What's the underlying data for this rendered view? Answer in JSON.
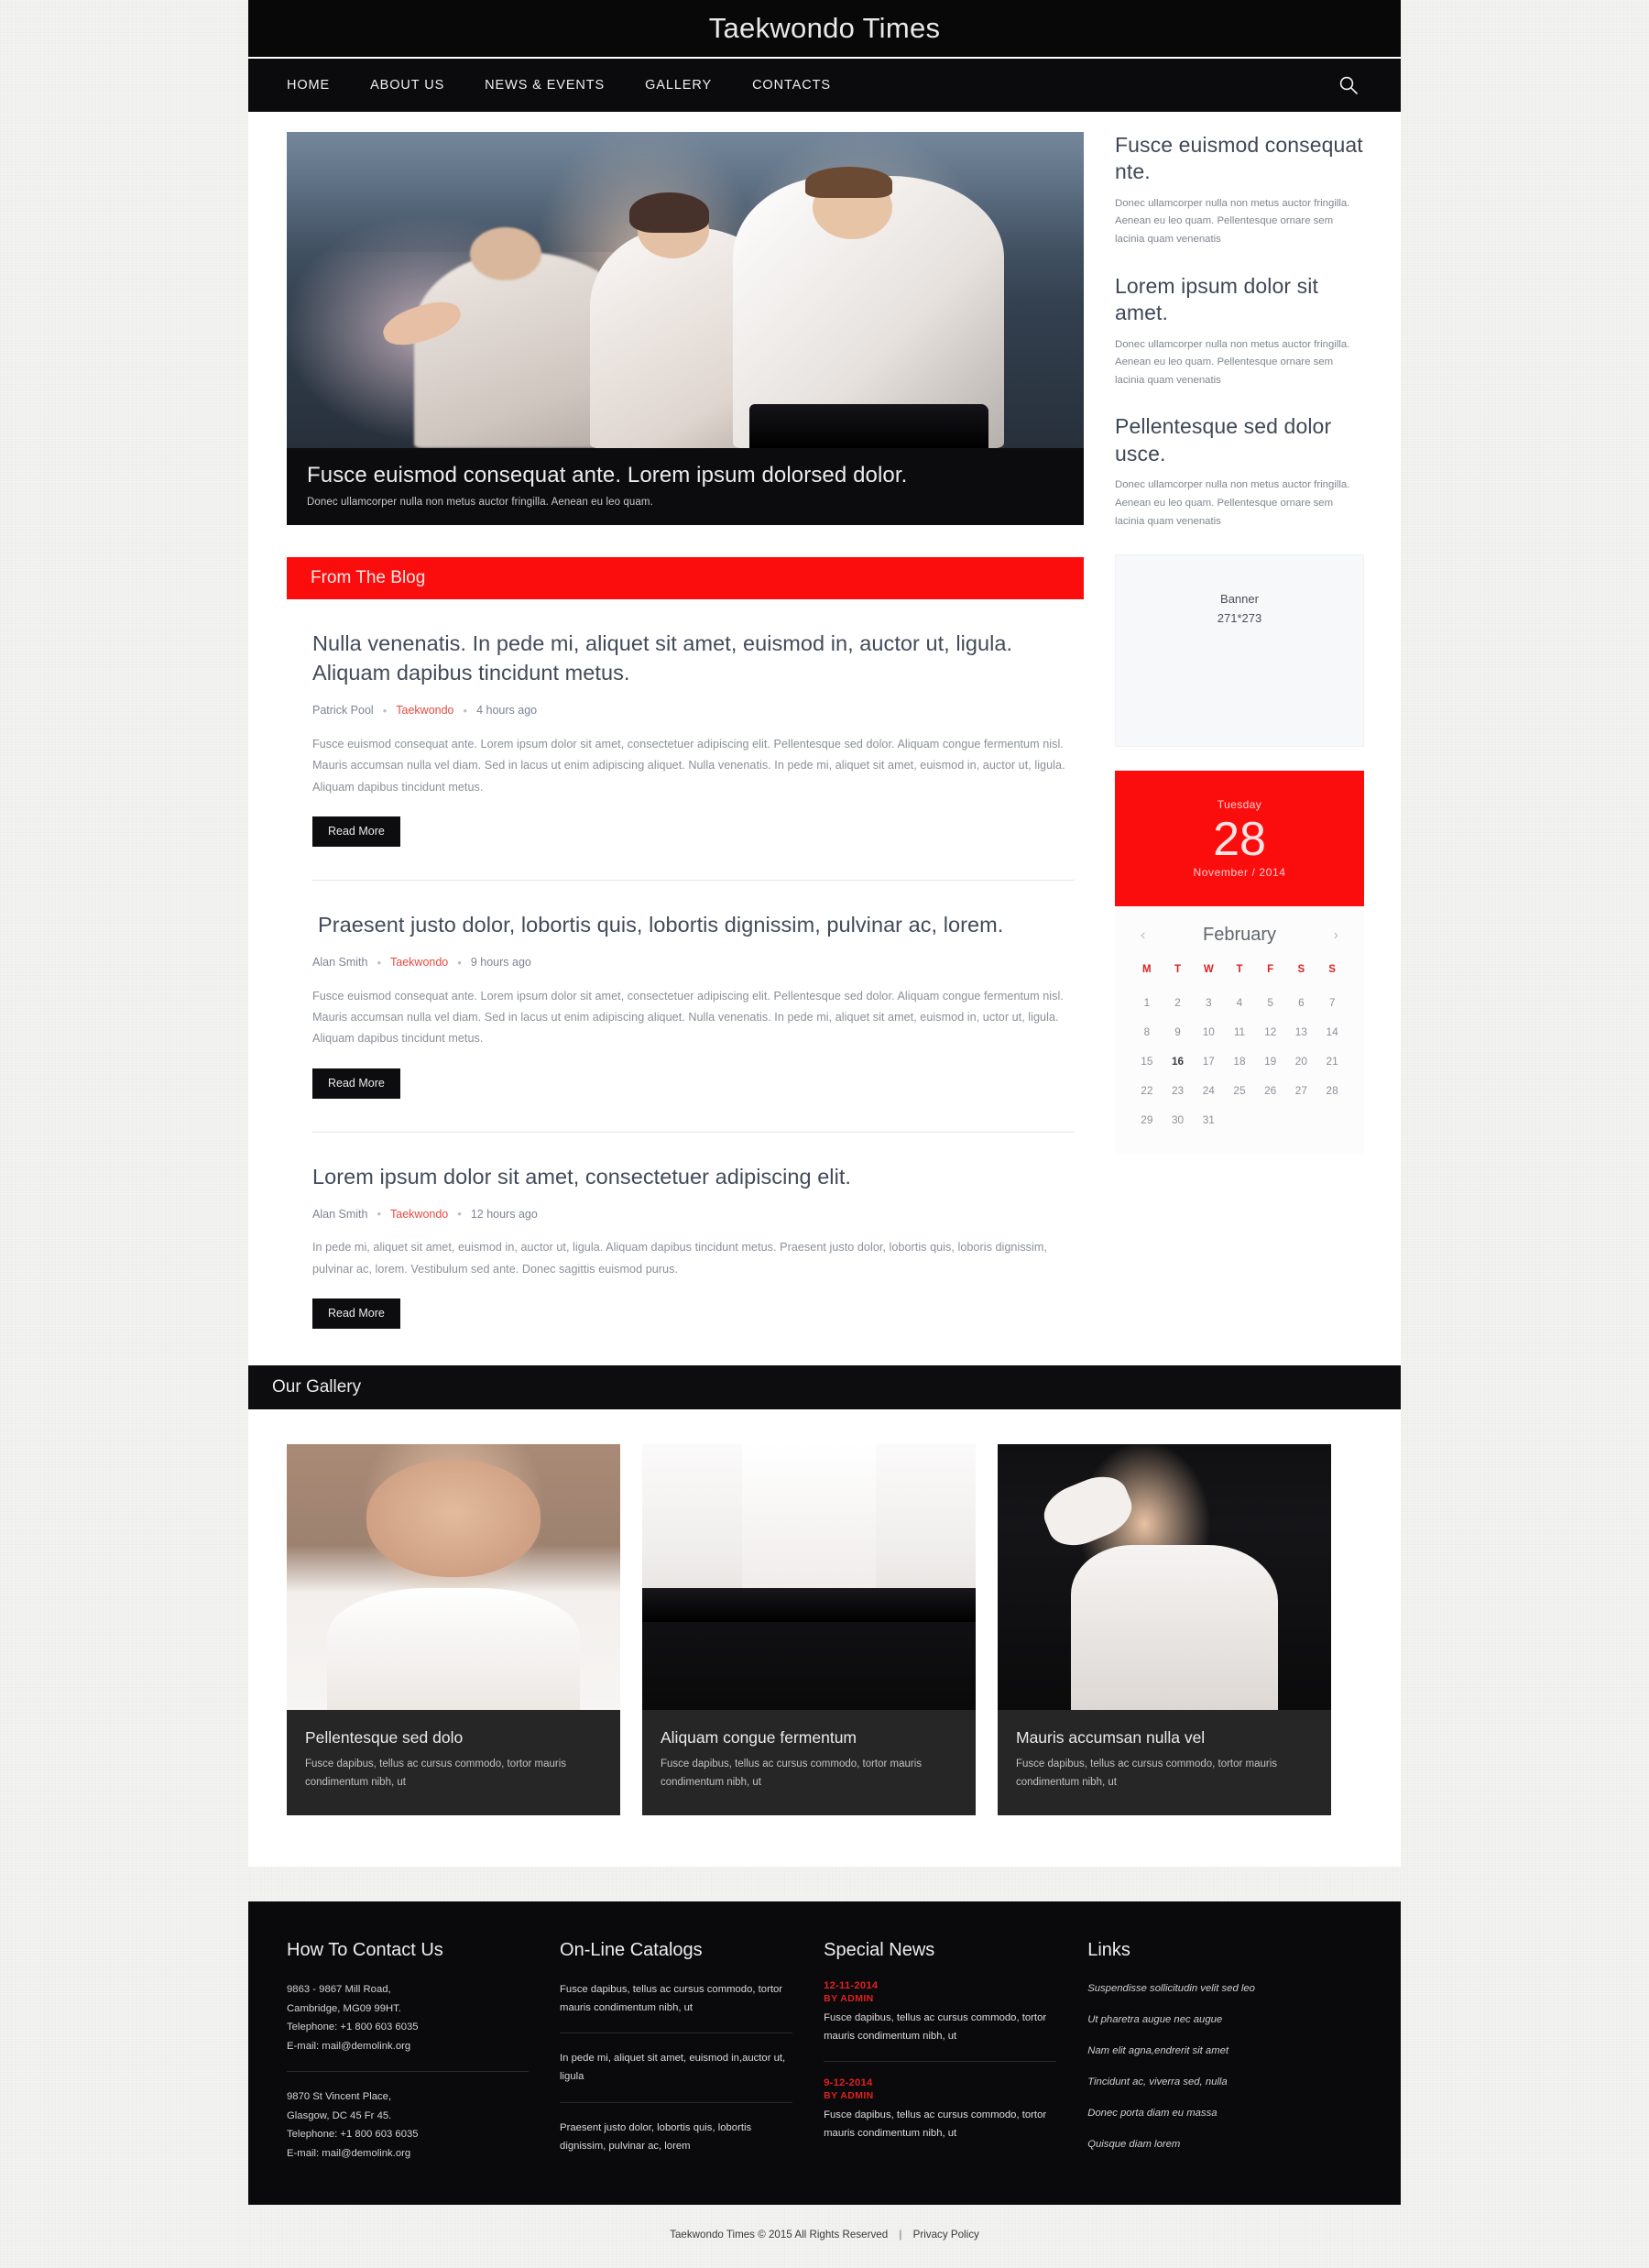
{
  "site": {
    "title": "Taekwondo Times"
  },
  "nav": {
    "items": [
      {
        "label": "HOME"
      },
      {
        "label": "ABOUT US"
      },
      {
        "label": "NEWS & EVENTS"
      },
      {
        "label": "GALLERY"
      },
      {
        "label": "CONTACTS"
      }
    ],
    "search_icon": "search-icon"
  },
  "hero": {
    "title": "Fusce euismod consequat ante. Lorem ipsum dolorsed dolor.",
    "subtitle": "Donec ullamcorper nulla non metus auctor fringilla. Aenean eu leo quam."
  },
  "blog": {
    "section_title": "From The Blog",
    "read_more_label": "Read More",
    "posts": [
      {
        "title": "Nulla venenatis. In pede mi, aliquet sit amet, euismod in, auctor ut, ligula. Aliquam dapibus tincidunt metus.",
        "author": "Patrick Pool",
        "category": "Taekwondo",
        "time": "4 hours ago",
        "body": "Fusce euismod consequat ante. Lorem ipsum dolor sit amet, consectetuer adipiscing elit. Pellentesque sed dolor. Aliquam congue fermentum nisl. Mauris accumsan nulla vel diam. Sed in lacus ut enim adipiscing aliquet. Nulla venenatis. In pede mi, aliquet sit amet, euismod in, auctor ut, ligula. Aliquam dapibus tincidunt metus."
      },
      {
        "title": "Praesent justo dolor, lobortis quis, lobortis dignissim, pulvinar ac, lorem.",
        "author": "Alan Smith",
        "category": "Taekwondo",
        "time": "9 hours ago",
        "body": "Fusce euismod consequat ante. Lorem ipsum dolor sit amet, consectetuer adipiscing elit. Pellentesque sed dolor. Aliquam congue fermentum nisl. Mauris accumsan nulla vel diam. Sed in lacus ut enim adipiscing aliquet. Nulla venenatis. In pede mi, aliquet sit amet, euismod in, uctor ut, ligula. Aliquam dapibus tincidunt metus."
      },
      {
        "title": "Lorem ipsum dolor sit amet, consectetuer adipiscing elit.",
        "author": "Alan Smith",
        "category": "Taekwondo",
        "time": "12 hours ago",
        "body": "In pede mi, aliquet sit amet, euismod in, auctor ut, ligula. Aliquam dapibus tincidunt metus. Praesent justo dolor, lobortis quis, loboris dignissim, pulvinar ac, lorem. Vestibulum sed ante. Donec sagittis euismod purus."
      }
    ]
  },
  "sidebar": {
    "blocks": [
      {
        "heading": "Fusce euismod consequat nte.",
        "text": "Donec ullamcorper nulla non metus auctor fringilla. Aenean eu leo quam. Pellentesque ornare sem lacinia quam venenatis"
      },
      {
        "heading": "Lorem ipsum dolor sit amet.",
        "text": "Donec ullamcorper nulla non metus auctor fringilla. Aenean eu leo quam. Pellentesque ornare sem lacinia quam venenatis"
      },
      {
        "heading": "Pellentesque sed dolor usce.",
        "text": "Donec ullamcorper nulla non metus auctor fringilla. Aenean eu leo quam. Pellentesque ornare sem lacinia quam venenatis"
      }
    ],
    "banner": {
      "label": "Banner",
      "size": "271*273"
    },
    "daycard": {
      "weekday": "Tuesday",
      "day": "28",
      "month_year": "November / 2014"
    },
    "calendar": {
      "month": "February",
      "prev_icon": "chevron-left-icon",
      "next_icon": "chevron-right-icon",
      "weekdays": [
        "M",
        "T",
        "W",
        "T",
        "F",
        "S",
        "S"
      ],
      "weeks": [
        [
          "1",
          "2",
          "3",
          "4",
          "5",
          "6",
          "7"
        ],
        [
          "8",
          "9",
          "10",
          "11",
          "12",
          "13",
          "14"
        ],
        [
          "15",
          "16",
          "17",
          "18",
          "19",
          "20",
          "21"
        ],
        [
          "22",
          "23",
          "24",
          "25",
          "26",
          "27",
          "28"
        ],
        [
          "29",
          "30",
          "31",
          "",
          "",
          "",
          ""
        ]
      ],
      "selected_day": "16"
    }
  },
  "gallery": {
    "section_title": "Our Gallery",
    "items": [
      {
        "title": "Pellentesque sed dolo",
        "caption": "Fusce dapibus, tellus ac cursus commodo, tortor mauris condimentum nibh, ut"
      },
      {
        "title": "Aliquam congue fermentum",
        "caption": "Fusce dapibus, tellus ac cursus commodo, tortor mauris condimentum nibh, ut"
      },
      {
        "title": "Mauris accumsan nulla vel",
        "caption": "Fusce dapibus, tellus ac cursus commodo, tortor mauris condimentum nibh, ut"
      }
    ]
  },
  "footer": {
    "contact": {
      "heading": "How To Contact Us",
      "addresses": [
        {
          "line1": "9863 - 9867 Mill Road,",
          "line2": "Cambridge, MG09 99HT.",
          "phone": "Telephone:  +1 800 603 6035",
          "email": "E-mail: mail@demolink.org"
        },
        {
          "line1": "9870 St Vincent Place,",
          "line2": "Glasgow, DC 45 Fr 45.",
          "phone": "Telephone:  +1 800 603 6035",
          "email": "E-mail: mail@demolink.org"
        }
      ]
    },
    "catalogs": {
      "heading": "On-Line Catalogs",
      "items": [
        "Fusce dapibus, tellus ac cursus commodo, tortor mauris condimentum nibh, ut",
        "In pede mi, aliquet sit amet, euismod in,auctor ut, ligula",
        "Praesent justo dolor, lobortis quis, lobortis dignissim, pulvinar ac, lorem"
      ]
    },
    "news": {
      "heading": "Special News",
      "items": [
        {
          "date": "12-11-2014",
          "by": "BY ADMIN",
          "text": "Fusce dapibus, tellus ac cursus commodo, tortor mauris condimentum nibh, ut"
        },
        {
          "date": "9-12-2014",
          "by": "BY ADMIN",
          "text": "Fusce dapibus, tellus ac cursus commodo, tortor mauris condimentum nibh, ut"
        }
      ]
    },
    "links": {
      "heading": "Links",
      "items": [
        "Suspendisse sollicitudin velit sed leo",
        "Ut pharetra augue nec augue",
        "Nam elit agna,endrerit sit amet",
        "Tincidunt ac, viverra sed, nulla",
        "Donec porta diam eu massa",
        "Quisque diam lorem"
      ]
    }
  },
  "copyright": {
    "text": "Taekwondo Times © 2015 All Rights Reserved",
    "privacy": "Privacy Policy"
  },
  "colors": {
    "accent_red": "#fc0d0d",
    "dark": "#0a0a0c",
    "heading": "#424b5a"
  }
}
